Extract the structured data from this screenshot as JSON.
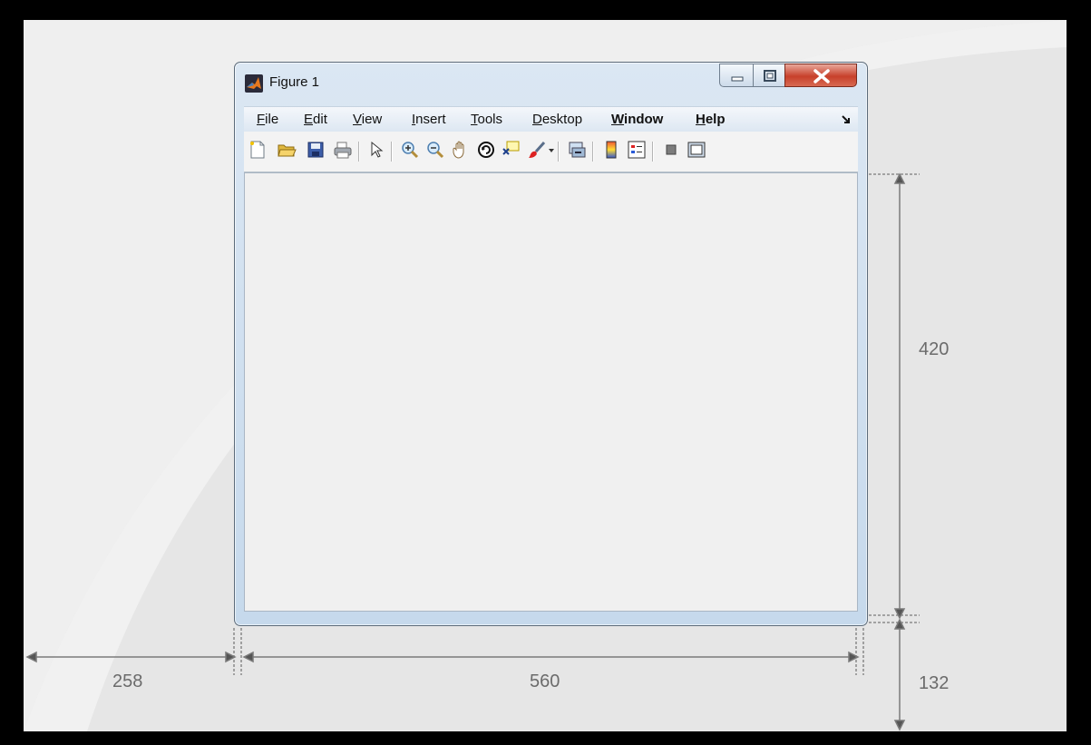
{
  "window": {
    "title": "Figure 1",
    "menus": [
      {
        "id": "file",
        "first": "F",
        "rest": "ile",
        "underline": "first"
      },
      {
        "id": "edit",
        "first": "E",
        "rest": "dit",
        "underline": "first"
      },
      {
        "id": "view",
        "first": "V",
        "rest": "iew",
        "underline": "first"
      },
      {
        "id": "insert",
        "first": "I",
        "rest": "nsert",
        "underline": "first"
      },
      {
        "id": "tools",
        "first": "T",
        "rest": "ools",
        "underline": "first"
      },
      {
        "id": "desktop",
        "first": "D",
        "rest": "esktop",
        "underline": "first"
      },
      {
        "id": "window",
        "first": "W",
        "rest": "indow",
        "underline": "first"
      },
      {
        "id": "help",
        "first": "H",
        "rest": "elp",
        "underline": "first"
      }
    ],
    "toolbar_icons": [
      "new-figure-icon",
      "open-file-icon",
      "save-icon",
      "print-icon",
      "edit-plot-arrow-icon",
      "zoom-in-icon",
      "zoom-out-icon",
      "pan-hand-icon",
      "rotate-3d-icon",
      "data-cursor-icon",
      "brush-icon",
      "link-plot-icon",
      "colorbar-icon",
      "legend-icon",
      "hide-plot-tools-icon",
      "show-plot-tools-icon"
    ],
    "buttons": [
      "minimize-icon",
      "maximize-icon",
      "close-icon"
    ]
  },
  "annotations": {
    "left": "258",
    "width": "560",
    "height": "420",
    "bottom": "132"
  },
  "colors": {
    "background": "#e6e6e6",
    "window_frame": "#c6d9ec",
    "close": "#c7402b"
  }
}
